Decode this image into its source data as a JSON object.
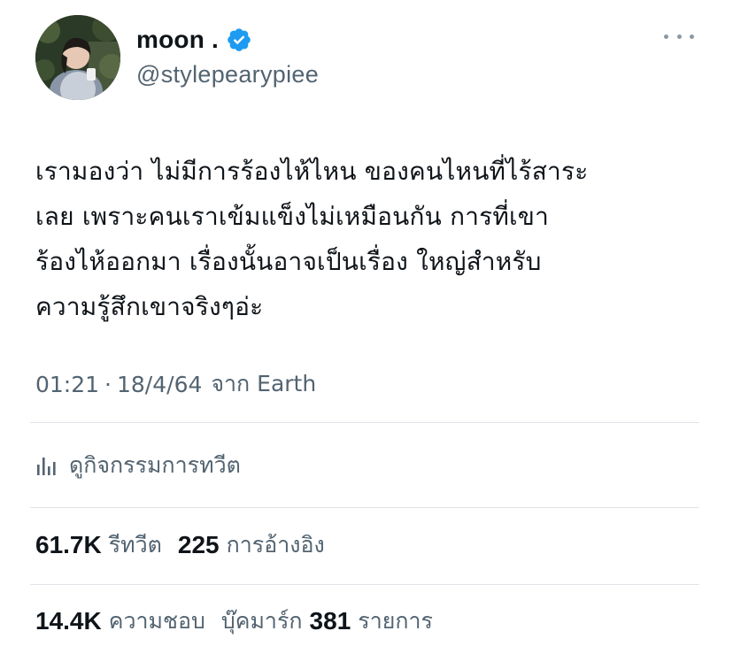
{
  "author": {
    "display_name": "moon .",
    "handle": "@stylepearypiee",
    "verified": true,
    "verified_color": "#1d9bf0"
  },
  "tweet": {
    "text": "เรามองว่า ไม่มีการร้องไห้ไหน ของคนไหนที่ไร้สาระ\nเลย เพราะคนเราเข้มแข็งไม่เหมือนกัน การที่เขา\nร้องไห้ออกมา เรื่องนั้นอาจเป็นเรื่อง ใหญ่สำหรับ\nความรู้สึกเขาจริงๆอ่ะ",
    "time": "01:21",
    "separator": "·",
    "date": "18/4/64",
    "source": "จาก Earth"
  },
  "analytics": {
    "label": "ดูกิจกรรมการทวีต",
    "icon": "analytics-bar-icon"
  },
  "stats": {
    "retweets_count": "61.7K",
    "retweets_label": "รีทวีต",
    "quotes_count": "225",
    "quotes_label": "การอ้างอิง",
    "likes_count": "14.4K",
    "likes_label": "ความชอบ",
    "bookmarks_label": "บุ๊คมาร์ก",
    "bookmarks_count": "381",
    "bookmarks_suffix": "รายการ"
  },
  "colors": {
    "text_primary": "#0f1419",
    "text_secondary": "#536471",
    "divider": "#dfe3e7"
  }
}
